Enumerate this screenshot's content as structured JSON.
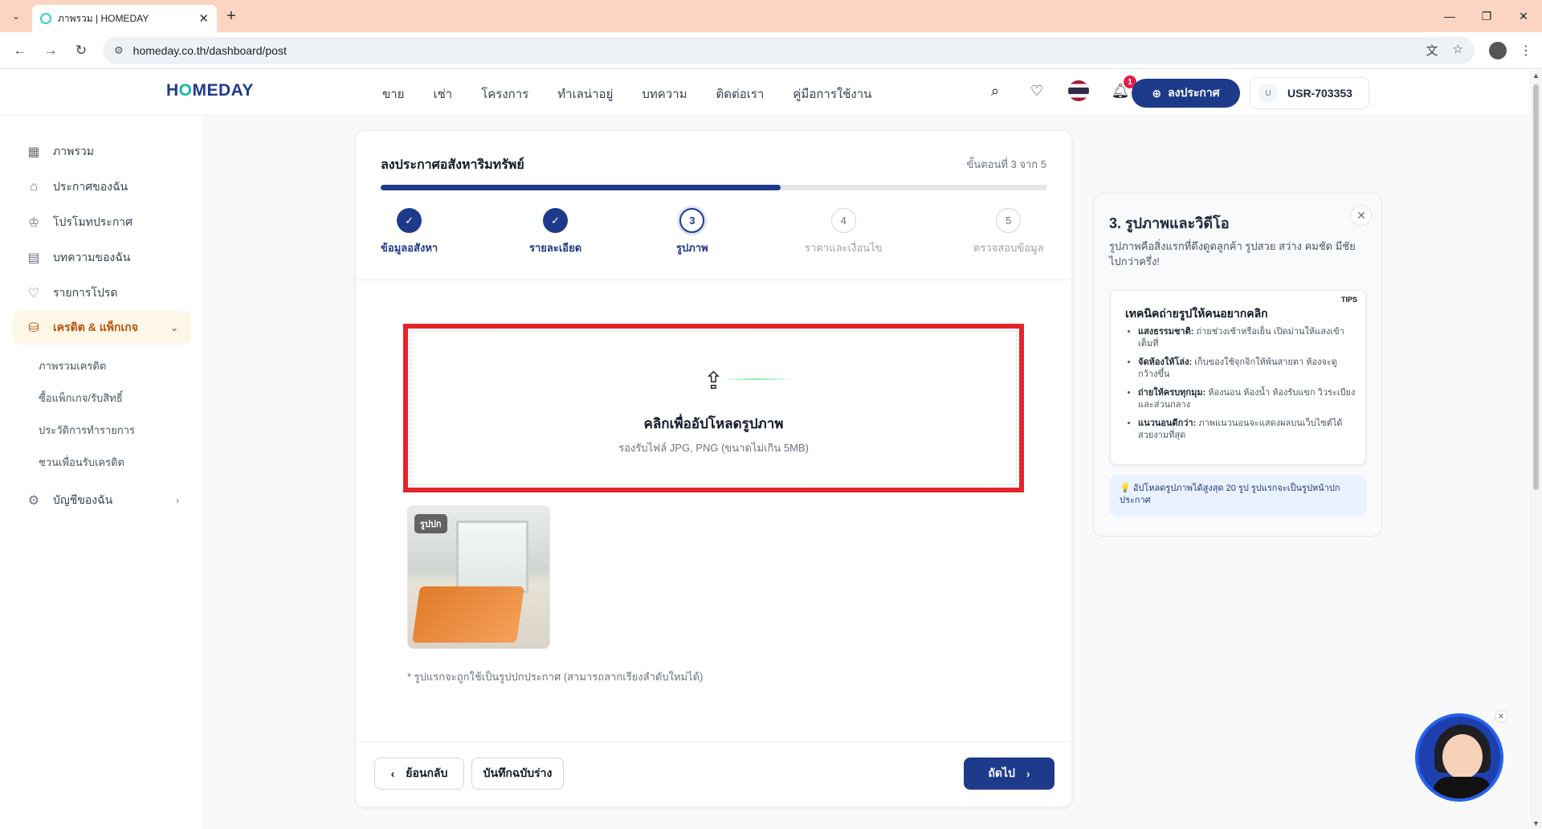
{
  "browser": {
    "tab_title": "ภาพรวม | HOMEDAY",
    "url": "homeday.co.th/dashboard/post"
  },
  "header": {
    "logo": "HOMEDAY",
    "nav": [
      "ขาย",
      "เช่า",
      "โครงการ",
      "ทำเลน่าอยู่",
      "บทความ",
      "ติดต่อเรา",
      "คู่มือการใช้งาน"
    ],
    "notification_count": "1",
    "post_button": "ลงประกาศ",
    "user_initial": "U",
    "user_id": "USR-703353"
  },
  "sidebar": {
    "items": [
      {
        "label": "ภาพรวม",
        "icon": "grid-icon"
      },
      {
        "label": "ประกาศของฉัน",
        "icon": "home-icon"
      },
      {
        "label": "โปรโมทประกาศ",
        "icon": "crown-icon"
      },
      {
        "label": "บทความของฉัน",
        "icon": "document-icon"
      },
      {
        "label": "รายการโปรด",
        "icon": "heart-icon"
      },
      {
        "label": "เครดิต & แพ็กเกจ",
        "icon": "coins-icon"
      }
    ],
    "subitems": [
      "ภาพรวมเครดิต",
      "ซื้อแพ็กเกจ/รับสิทธิ์",
      "ประวัติการทำรายการ",
      "ชวนเพื่อนรับเครดิต"
    ],
    "account": "บัญชีของฉัน"
  },
  "form": {
    "title": "ลงประกาศอสังหาริมทรัพย์",
    "step_counter": "ขั้นตอนที่ 3 จาก 5",
    "progress": 0.6,
    "steps": [
      {
        "num": "1",
        "label": "ข้อมูลอสังหา",
        "state": "done"
      },
      {
        "num": "2",
        "label": "รายละเอียด",
        "state": "done"
      },
      {
        "num": "3",
        "label": "รูปภาพ",
        "state": "current"
      },
      {
        "num": "4",
        "label": "ราคาและเงื่อนไข",
        "state": "todo"
      },
      {
        "num": "5",
        "label": "ตรวจสอบข้อมูล",
        "state": "todo"
      }
    ],
    "upload_title": "คลิกเพื่ออัปโหลดรูปภาพ",
    "upload_sub": "รองรับไฟล์ JPG, PNG (ขนาดไม่เกิน 5MB)",
    "cover_badge": "รูปปก",
    "note": "* รูปแรกจะถูกใช้เป็นรูปปกประกาศ (สามารถลากเรียงลำดับใหม่ได้)",
    "back": "ย้อนกลับ",
    "save_draft": "บันทึกฉบับร่าง",
    "next": "ถัดไป"
  },
  "help": {
    "title": "3. รูปภาพและวิดีโอ",
    "desc": "รูปภาพคือสิ่งแรกที่ดึงดูดลูกค้า รูปสวย สว่าง คมชัด มีชัยไปกว่าครึ่ง!",
    "tips_tag": "TIPS",
    "tips_title": "เทคนิคถ่ายรูปให้คนอยากคลิก",
    "tips": [
      {
        "bold": "แสงธรรมชาติ:",
        "text": " ถ่ายช่วงเช้าหรือเย็น เปิดม่านให้แสงเข้าเต็มที่"
      },
      {
        "bold": "จัดห้องให้โล่ง:",
        "text": " เก็บของใช้จุกจิกให้พ้นสายตา ห้องจะดูกว้างขึ้น"
      },
      {
        "bold": "ถ่ายให้ครบทุกมุม:",
        "text": " ห้องนอน ห้องน้ำ ห้องรับแขก วิวระเบียง และส่วนกลาง"
      },
      {
        "bold": "แนวนอนดีกว่า:",
        "text": " ภาพแนวนอนจะแสดงผลบนเว็บไซต์ได้สวยงามที่สุด"
      }
    ],
    "hint": "💡 อัปโหลดรูปภาพได้สูงสุด 20 รูป รูปแรกจะเป็นรูปหน้าปกประกาศ"
  }
}
